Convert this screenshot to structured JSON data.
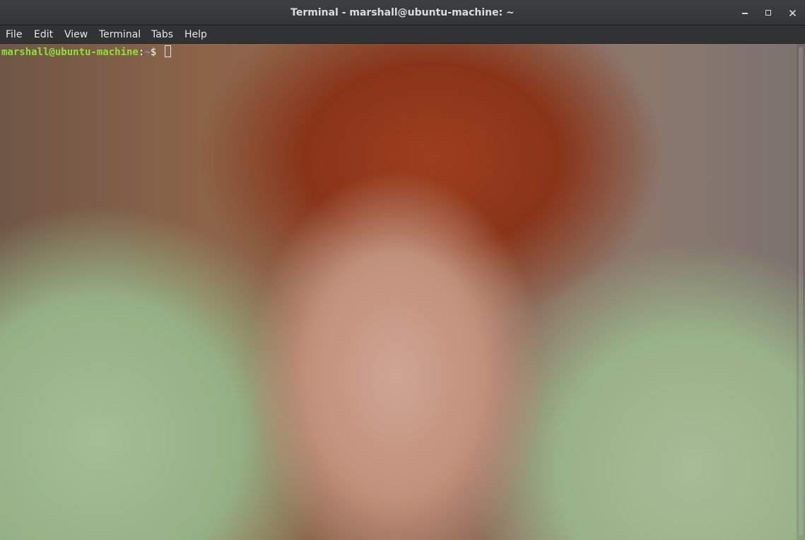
{
  "window": {
    "title": "Terminal - marshall@ubuntu-machine: ~"
  },
  "menu": [
    {
      "label": "File"
    },
    {
      "label": "Edit"
    },
    {
      "label": "View"
    },
    {
      "label": "Terminal"
    },
    {
      "label": "Tabs"
    },
    {
      "label": "Help"
    }
  ],
  "terminal": {
    "prompt_user": "marshall@ubuntu-machine",
    "prompt_colon": ":",
    "prompt_path": "~",
    "prompt_symbol": "$ "
  },
  "icons": {
    "minimize": "minimize-icon",
    "maximize": "maximize-icon",
    "close": "close-icon"
  },
  "colors": {
    "prompt_user": "#8ae234",
    "prompt_path": "#729fcf",
    "titlebar": "#3a3c3e",
    "menubar": "#303234"
  }
}
